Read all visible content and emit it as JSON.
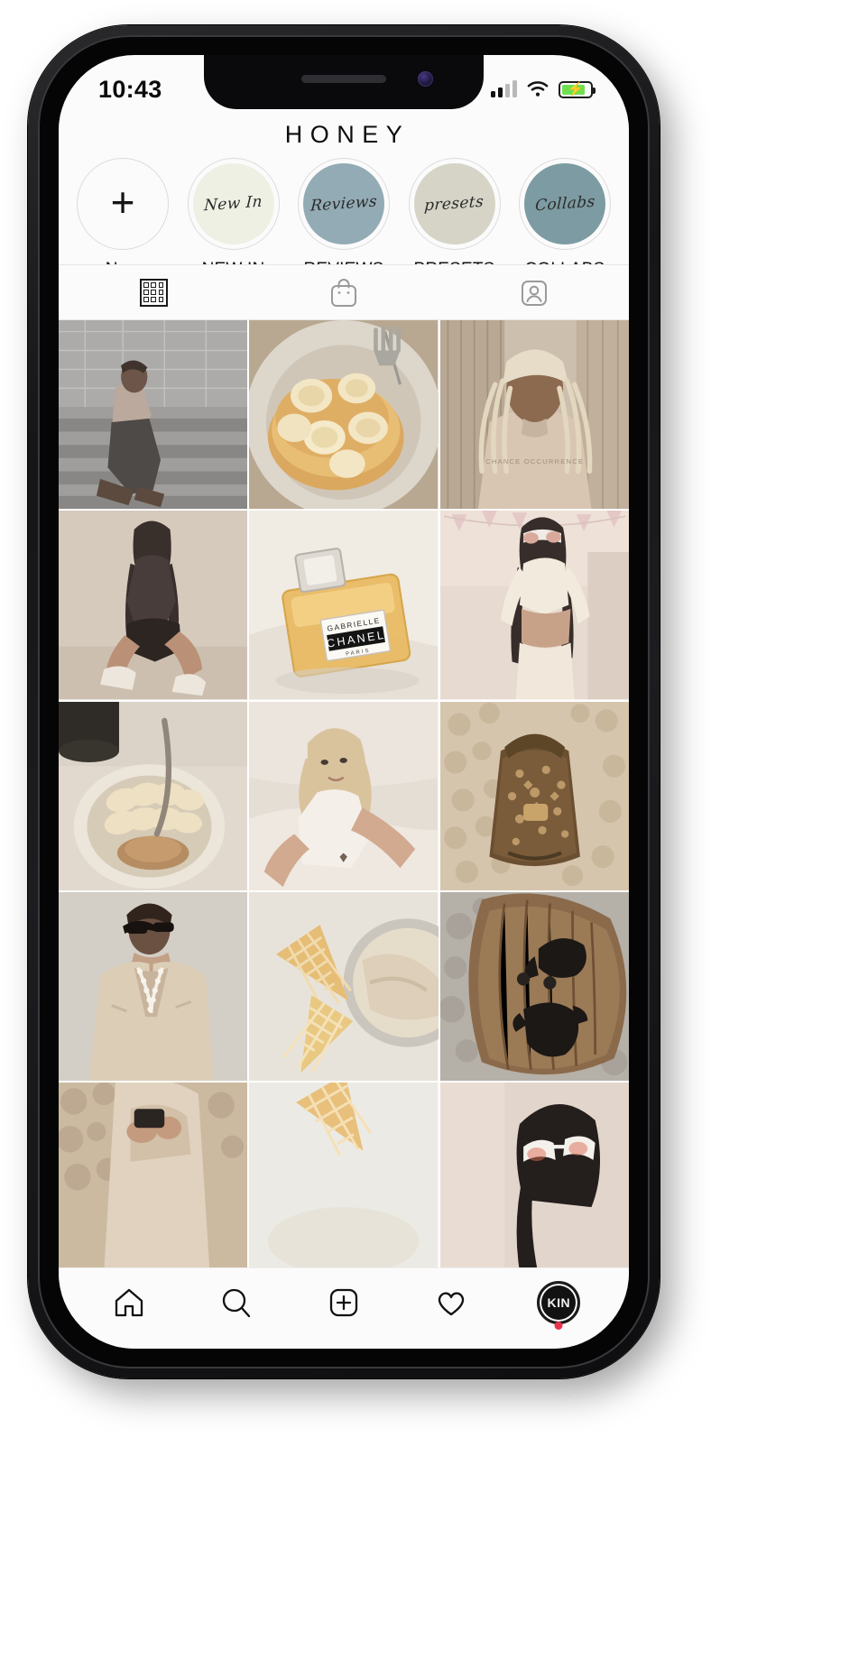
{
  "device": {
    "name": "iphone-x-mockup",
    "notch": true
  },
  "status_bar": {
    "time": "10:43",
    "signal_icon": "cellular-signal-icon",
    "wifi_icon": "wifi-icon",
    "battery_icon": "battery-charging-icon",
    "battery_color": "#6ee04f"
  },
  "header": {
    "title": "HONEY"
  },
  "highlights": [
    {
      "label": "New",
      "script": "",
      "bg": "#fbfbfb",
      "icon": "plus-icon"
    },
    {
      "label": "NEW IN",
      "script": "New In",
      "bg": "#eef0e4",
      "icon": ""
    },
    {
      "label": "REVIEWS",
      "script": "Reviews",
      "bg": "#93abb5",
      "icon": ""
    },
    {
      "label": "PRESETS",
      "script": "presets",
      "bg": "#d5d4c6",
      "icon": ""
    },
    {
      "label": "COLLABS",
      "script": "Collabs",
      "bg": "#7d9ba2",
      "icon": ""
    }
  ],
  "tabs": [
    {
      "name": "grid-tab",
      "icon": "grid-icon",
      "active": true
    },
    {
      "name": "shop-tab",
      "icon": "shopping-bag-icon",
      "active": false
    },
    {
      "name": "tagged-tab",
      "icon": "tagged-person-icon",
      "active": false
    }
  ],
  "feed": {
    "posts": [
      {
        "alt": "man-in-beige-turtleneck-on-stairs",
        "theme": "mono-stairs"
      },
      {
        "alt": "pancakes-with-banana-slices",
        "theme": "pancakes"
      },
      {
        "alt": "woman-with-long-braids-in-hoodie",
        "theme": "braids"
      },
      {
        "alt": "woman-crouching-in-black-bodysuit",
        "theme": "crouch"
      },
      {
        "alt": "chanel-gabrielle-perfume-bottle",
        "theme": "perfume"
      },
      {
        "alt": "woman-in-cream-crop-top-sunglasses",
        "theme": "croptop"
      },
      {
        "alt": "oatmeal-bowl-with-banana-and-coffee",
        "theme": "oatmeal"
      },
      {
        "alt": "blonde-woman-in-white-tank-in-bed",
        "theme": "blonde"
      },
      {
        "alt": "louis-vuitton-backpack-on-sherpa",
        "theme": "backpack"
      },
      {
        "alt": "person-in-beige-blazer-with-pearls",
        "theme": "blazer"
      },
      {
        "alt": "waffle-cones-and-ice-cream-tub",
        "theme": "icecream"
      },
      {
        "alt": "black-swimwear-on-wooden-table",
        "theme": "swimwear"
      },
      {
        "alt": "hands-on-sherpa-jacket",
        "theme": "sherpa2"
      },
      {
        "alt": "waffle-cone-closeup",
        "theme": "cone2"
      },
      {
        "alt": "woman-in-white-sunglasses",
        "theme": "sunglasses2"
      }
    ],
    "perfume_label": {
      "brand": "CHANEL",
      "line": "GABRIELLE",
      "city": "PARIS"
    }
  },
  "bottom_nav": [
    {
      "name": "home-nav",
      "icon": "home-icon"
    },
    {
      "name": "search-nav",
      "icon": "search-icon"
    },
    {
      "name": "create-nav",
      "icon": "plus-square-icon"
    },
    {
      "name": "activity-nav",
      "icon": "heart-icon"
    },
    {
      "name": "profile-nav",
      "icon": "avatar",
      "avatar_text": "KIN",
      "badge": true,
      "badge_color": "#e8344e"
    }
  ]
}
